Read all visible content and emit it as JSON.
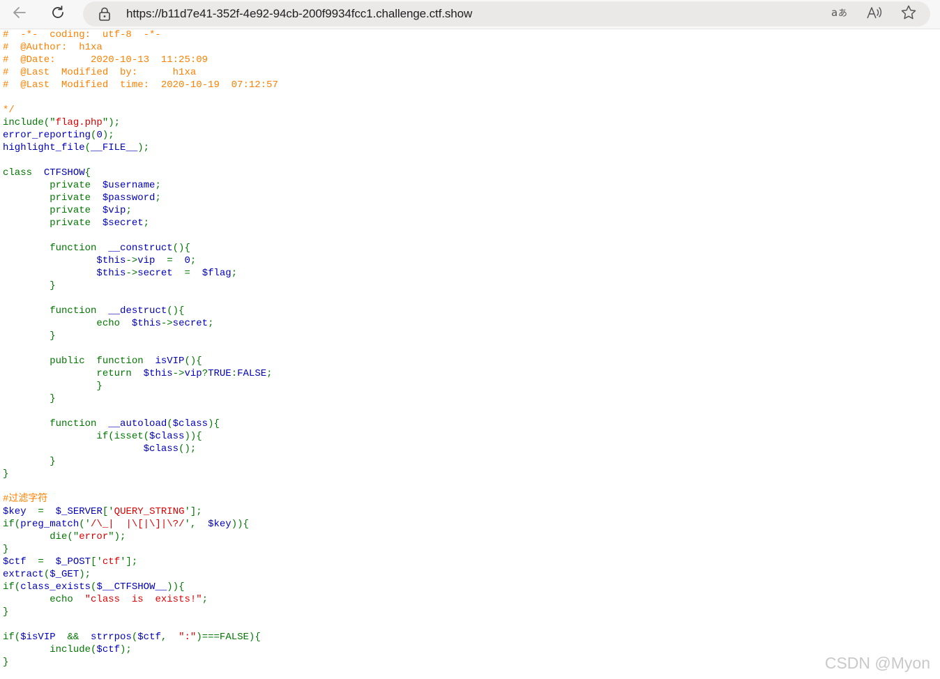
{
  "browser": {
    "url": "https://b11d7e41-352f-4e92-94cb-200f9934fcc1.challenge.ctf.show",
    "back_icon": "arrow-left-icon",
    "reload_icon": "reload-icon",
    "site_info_icon": "lock-icon",
    "translate_icon": "translate-icon",
    "read_aloud_icon": "read-aloud-icon",
    "favorite_icon": "star-icon"
  },
  "colors": {
    "comment": "#ff8000",
    "keyword": "#007700",
    "default": "#0000bb",
    "string": "#dd0000"
  },
  "source_lines": [
    [
      {
        "t": "c",
        "v": "#  -*-  coding:  utf-8  -*-"
      }
    ],
    [
      {
        "t": "c",
        "v": "#  @Author:  h1xa"
      }
    ],
    [
      {
        "t": "c",
        "v": "#  @Date:      2020-10-13  11:25:09"
      }
    ],
    [
      {
        "t": "c",
        "v": "#  @Last  Modified  by:      h1xa"
      }
    ],
    [
      {
        "t": "c",
        "v": "#  @Last  Modified  time:  2020-10-19  07:12:57"
      }
    ],
    [],
    [
      {
        "t": "c",
        "v": "*/"
      }
    ],
    [
      {
        "t": "k",
        "v": "include(\""
      },
      {
        "t": "s",
        "v": "flag.php"
      },
      {
        "t": "k",
        "v": "\");"
      }
    ],
    [
      {
        "t": "d",
        "v": "error_reporting"
      },
      {
        "t": "k",
        "v": "("
      },
      {
        "t": "d",
        "v": "0"
      },
      {
        "t": "k",
        "v": ");"
      }
    ],
    [
      {
        "t": "d",
        "v": "highlight_file"
      },
      {
        "t": "k",
        "v": "("
      },
      {
        "t": "d",
        "v": "__FILE__"
      },
      {
        "t": "k",
        "v": ");"
      }
    ],
    [],
    [
      {
        "t": "k",
        "v": "class  "
      },
      {
        "t": "d",
        "v": "CTFSHOW"
      },
      {
        "t": "k",
        "v": "{"
      }
    ],
    [
      {
        "t": "k",
        "v": "        private  "
      },
      {
        "t": "d",
        "v": "$username"
      },
      {
        "t": "k",
        "v": ";"
      }
    ],
    [
      {
        "t": "k",
        "v": "        private  "
      },
      {
        "t": "d",
        "v": "$password"
      },
      {
        "t": "k",
        "v": ";"
      }
    ],
    [
      {
        "t": "k",
        "v": "        private  "
      },
      {
        "t": "d",
        "v": "$vip"
      },
      {
        "t": "k",
        "v": ";"
      }
    ],
    [
      {
        "t": "k",
        "v": "        private  "
      },
      {
        "t": "d",
        "v": "$secret"
      },
      {
        "t": "k",
        "v": ";"
      }
    ],
    [],
    [
      {
        "t": "k",
        "v": "        function  "
      },
      {
        "t": "d",
        "v": "__construct"
      },
      {
        "t": "k",
        "v": "(){"
      }
    ],
    [
      {
        "t": "k",
        "v": "                "
      },
      {
        "t": "d",
        "v": "$this"
      },
      {
        "t": "k",
        "v": "->"
      },
      {
        "t": "d",
        "v": "vip  "
      },
      {
        "t": "k",
        "v": "=  "
      },
      {
        "t": "d",
        "v": "0"
      },
      {
        "t": "k",
        "v": ";"
      }
    ],
    [
      {
        "t": "k",
        "v": "                "
      },
      {
        "t": "d",
        "v": "$this"
      },
      {
        "t": "k",
        "v": "->"
      },
      {
        "t": "d",
        "v": "secret  "
      },
      {
        "t": "k",
        "v": "=  "
      },
      {
        "t": "d",
        "v": "$flag"
      },
      {
        "t": "k",
        "v": ";"
      }
    ],
    [
      {
        "t": "k",
        "v": "        }"
      }
    ],
    [],
    [
      {
        "t": "k",
        "v": "        function  "
      },
      {
        "t": "d",
        "v": "__destruct"
      },
      {
        "t": "k",
        "v": "(){"
      }
    ],
    [
      {
        "t": "k",
        "v": "                echo  "
      },
      {
        "t": "d",
        "v": "$this"
      },
      {
        "t": "k",
        "v": "->"
      },
      {
        "t": "d",
        "v": "secret"
      },
      {
        "t": "k",
        "v": ";"
      }
    ],
    [
      {
        "t": "k",
        "v": "        }"
      }
    ],
    [],
    [
      {
        "t": "k",
        "v": "        public  function  "
      },
      {
        "t": "d",
        "v": "isVIP"
      },
      {
        "t": "k",
        "v": "(){"
      }
    ],
    [
      {
        "t": "k",
        "v": "                return  "
      },
      {
        "t": "d",
        "v": "$this"
      },
      {
        "t": "k",
        "v": "->"
      },
      {
        "t": "d",
        "v": "vip"
      },
      {
        "t": "k",
        "v": "?"
      },
      {
        "t": "d",
        "v": "TRUE"
      },
      {
        "t": "k",
        "v": ":"
      },
      {
        "t": "d",
        "v": "FALSE"
      },
      {
        "t": "k",
        "v": ";"
      }
    ],
    [
      {
        "t": "k",
        "v": "                }"
      }
    ],
    [
      {
        "t": "k",
        "v": "        }"
      }
    ],
    [],
    [
      {
        "t": "k",
        "v": "        function  "
      },
      {
        "t": "d",
        "v": "__autoload"
      },
      {
        "t": "k",
        "v": "("
      },
      {
        "t": "d",
        "v": "$class"
      },
      {
        "t": "k",
        "v": "){"
      }
    ],
    [
      {
        "t": "k",
        "v": "                if(isset("
      },
      {
        "t": "d",
        "v": "$class"
      },
      {
        "t": "k",
        "v": ")){"
      }
    ],
    [
      {
        "t": "k",
        "v": "                        "
      },
      {
        "t": "d",
        "v": "$class"
      },
      {
        "t": "k",
        "v": "();"
      }
    ],
    [
      {
        "t": "k",
        "v": "        }"
      }
    ],
    [
      {
        "t": "k",
        "v": "}"
      }
    ],
    [],
    [
      {
        "t": "c",
        "v": "#过滤字符"
      }
    ],
    [
      {
        "t": "d",
        "v": "$key  "
      },
      {
        "t": "k",
        "v": "=  "
      },
      {
        "t": "d",
        "v": "$_SERVER"
      },
      {
        "t": "k",
        "v": "['"
      },
      {
        "t": "s",
        "v": "QUERY_STRING"
      },
      {
        "t": "k",
        "v": "'];"
      }
    ],
    [
      {
        "t": "k",
        "v": "if("
      },
      {
        "t": "d",
        "v": "preg_match"
      },
      {
        "t": "k",
        "v": "('"
      },
      {
        "t": "s",
        "v": "/\\_|  |\\[|\\]|\\?/"
      },
      {
        "t": "k",
        "v": "',  "
      },
      {
        "t": "d",
        "v": "$key"
      },
      {
        "t": "k",
        "v": ")){"
      }
    ],
    [
      {
        "t": "k",
        "v": "        die(\""
      },
      {
        "t": "s",
        "v": "error"
      },
      {
        "t": "k",
        "v": "\");"
      }
    ],
    [
      {
        "t": "k",
        "v": "}"
      }
    ],
    [
      {
        "t": "d",
        "v": "$ctf  "
      },
      {
        "t": "k",
        "v": "=  "
      },
      {
        "t": "d",
        "v": "$_POST"
      },
      {
        "t": "k",
        "v": "['"
      },
      {
        "t": "s",
        "v": "ctf"
      },
      {
        "t": "k",
        "v": "'];"
      }
    ],
    [
      {
        "t": "d",
        "v": "extract"
      },
      {
        "t": "k",
        "v": "("
      },
      {
        "t": "d",
        "v": "$_GET"
      },
      {
        "t": "k",
        "v": ");"
      }
    ],
    [
      {
        "t": "k",
        "v": "if("
      },
      {
        "t": "d",
        "v": "class_exists"
      },
      {
        "t": "k",
        "v": "("
      },
      {
        "t": "d",
        "v": "$__CTFSHOW__"
      },
      {
        "t": "k",
        "v": ")){"
      }
    ],
    [
      {
        "t": "k",
        "v": "        echo  "
      },
      {
        "t": "s",
        "v": "\"class  is  exists!\""
      },
      {
        "t": "k",
        "v": ";"
      }
    ],
    [
      {
        "t": "k",
        "v": "}"
      }
    ],
    [],
    [
      {
        "t": "k",
        "v": "if("
      },
      {
        "t": "d",
        "v": "$isVIP  "
      },
      {
        "t": "k",
        "v": "&&  "
      },
      {
        "t": "d",
        "v": "strrpos"
      },
      {
        "t": "k",
        "v": "("
      },
      {
        "t": "d",
        "v": "$ctf"
      },
      {
        "t": "k",
        "v": ",  "
      },
      {
        "t": "s",
        "v": "\":\""
      },
      {
        "t": "k",
        "v": ")===FALSE){"
      }
    ],
    [
      {
        "t": "k",
        "v": "        include("
      },
      {
        "t": "d",
        "v": "$ctf"
      },
      {
        "t": "k",
        "v": ");"
      }
    ],
    [
      {
        "t": "k",
        "v": "}"
      }
    ]
  ],
  "watermark": "CSDN @Myon"
}
